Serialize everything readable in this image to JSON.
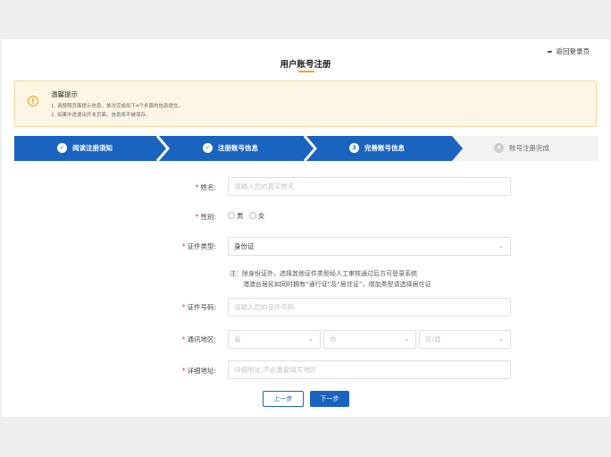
{
  "header": {
    "title": "用户账号注册",
    "back_link": "返回登录页"
  },
  "notice": {
    "icon": "warning-icon",
    "title": "温馨提示",
    "lines": [
      "1. 请按照页面提示信息，依次完成如下4个步骤的信息提交。",
      "2. 如果中途退出开本页面，信息将不被保存。"
    ]
  },
  "steps": [
    {
      "label": "阅读注册须知",
      "status": "done",
      "marker": "✓"
    },
    {
      "label": "注册账号信息",
      "status": "done",
      "marker": "✓"
    },
    {
      "label": "完善账号信息",
      "status": "active",
      "marker": "3"
    },
    {
      "label": "账号注册完成",
      "status": "todo",
      "marker": "4"
    }
  ],
  "form": {
    "name": {
      "label": "姓名:",
      "placeholder": "请输入您的真实姓名"
    },
    "gender": {
      "label": "性别:",
      "options": [
        "男",
        "女"
      ]
    },
    "id_type": {
      "label": "证件类型:",
      "value": "身份证"
    },
    "id_note": {
      "prefix": "注：",
      "line1": "除身份证外，选择其他证件类型经人工审核通过后方可登录系统",
      "line2": "港澳台居民如同时拥有“通行证”及“居住证”，增加类型请选择居住证"
    },
    "id_number": {
      "label": "证件号码:",
      "placeholder": "请输入您的证件号码"
    },
    "region": {
      "label": "通讯地区:",
      "province": "省",
      "city": "市",
      "district": "区/县"
    },
    "address": {
      "label": "详细地址:",
      "placeholder": "详细地址,不必重复填写地区"
    }
  },
  "buttons": {
    "prev": "上一步",
    "next": "下一步"
  },
  "colors": {
    "primary": "#1a63be",
    "accent": "#f3a31b",
    "required": "#e0403a"
  }
}
